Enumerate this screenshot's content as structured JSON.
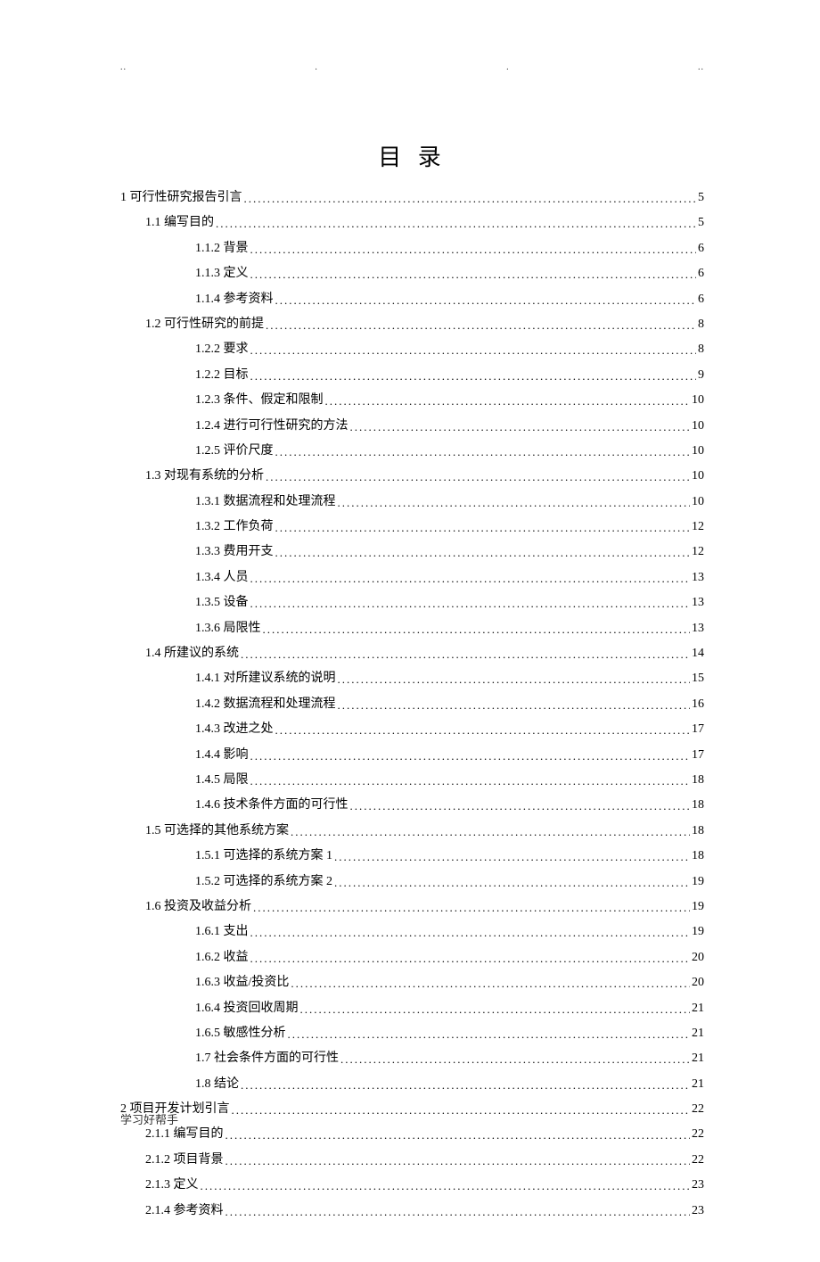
{
  "title": "目 录",
  "footer": "学习好帮手",
  "marker_chars": [
    "..",
    ".",
    ".",
    ".."
  ],
  "toc": [
    {
      "level": 1,
      "num": "1",
      "text": "可行性研究报告引言",
      "page": "5"
    },
    {
      "level": 2,
      "num": "1.1",
      "text": "编写目的",
      "page": "5"
    },
    {
      "level": 3,
      "num": "1.1.2",
      "text": "背景",
      "page": "6"
    },
    {
      "level": 3,
      "num": "1.1.3",
      "text": "定义",
      "page": "6"
    },
    {
      "level": 3,
      "num": "1.1.4",
      "text": "参考资料",
      "page": "6"
    },
    {
      "level": 2,
      "num": "1.2",
      "text": "可行性研究的前提",
      "page": "8"
    },
    {
      "level": 3,
      "num": "1.2.2",
      "text": "要求",
      "page": "8"
    },
    {
      "level": 3,
      "num": "1.2.2",
      "text": "目标",
      "page": "9"
    },
    {
      "level": 3,
      "num": "1.2.3",
      "text": "条件、假定和限制",
      "page": "10"
    },
    {
      "level": 3,
      "num": "1.2.4",
      "text": "进行可行性研究的方法",
      "page": "10"
    },
    {
      "level": 3,
      "num": "1.2.5",
      "text": "评价尺度",
      "page": "10"
    },
    {
      "level": 2,
      "num": "1.3",
      "text": "对现有系统的分析",
      "page": "10"
    },
    {
      "level": 3,
      "num": "1.3.1",
      "text": "数据流程和处理流程",
      "page": "10"
    },
    {
      "level": 3,
      "num": "1.3.2",
      "text": "工作负荷",
      "page": "12"
    },
    {
      "level": 3,
      "num": "1.3.3",
      "text": "费用开支",
      "page": "12"
    },
    {
      "level": 3,
      "num": "1.3.4",
      "text": "人员",
      "page": "13"
    },
    {
      "level": 3,
      "num": "1.3.5",
      "text": "设备",
      "page": "13"
    },
    {
      "level": 3,
      "num": "1.3.6",
      "text": "局限性",
      "page": "13"
    },
    {
      "level": 2,
      "num": "1.4",
      "text": "所建议的系统",
      "page": "14"
    },
    {
      "level": 3,
      "num": "1.4.1",
      "text": "对所建议系统的说明",
      "page": "15"
    },
    {
      "level": 3,
      "num": "1.4.2",
      "text": "数据流程和处理流程",
      "page": "16"
    },
    {
      "level": 3,
      "num": "1.4.3",
      "text": "改进之处",
      "page": "17"
    },
    {
      "level": 3,
      "num": "1.4.4",
      "text": "影响",
      "page": "17"
    },
    {
      "level": 3,
      "num": "1.4.5",
      "text": "局限",
      "page": "18"
    },
    {
      "level": 3,
      "num": "1.4.6",
      "text": "技术条件方面的可行性",
      "page": "18"
    },
    {
      "level": 2,
      "num": "1.5",
      "text": "可选择的其他系统方案",
      "page": "18"
    },
    {
      "level": 3,
      "num": "1.5.1",
      "text": "可选择的系统方案 1",
      "page": "18"
    },
    {
      "level": 3,
      "num": "1.5.2",
      "text": "可选择的系统方案 2",
      "page": "19"
    },
    {
      "level": 2,
      "num": "1.6",
      "text": "投资及收益分析",
      "page": "19"
    },
    {
      "level": 3,
      "num": "1.6.1",
      "text": "支出",
      "page": "19"
    },
    {
      "level": 3,
      "num": "1.6.2",
      "text": "收益",
      "page": "20"
    },
    {
      "level": 3,
      "num": "1.6.3",
      "text": "收益/投资比",
      "page": "20"
    },
    {
      "level": 3,
      "num": "1.6.4",
      "text": "投资回收周期",
      "page": "21"
    },
    {
      "level": 3,
      "num": "1.6.5",
      "text": "敏感性分析",
      "page": "21"
    },
    {
      "level": 3,
      "num": "1.7",
      "text": "社会条件方面的可行性",
      "page": "21"
    },
    {
      "level": 3,
      "num": "1.8",
      "text": "结论",
      "page": "21"
    },
    {
      "level": 1,
      "num": "2",
      "text": "项目开发计划引言",
      "page": "22"
    },
    {
      "level": 2,
      "num": "2.1.1",
      "text": "编写目的",
      "page": "22"
    },
    {
      "level": 2,
      "num": "2.1.2",
      "text": "项目背景",
      "page": "22"
    },
    {
      "level": 2,
      "num": "2.1.3",
      "text": "定义",
      "page": "23"
    },
    {
      "level": 2,
      "num": "2.1.4",
      "text": "参考资料",
      "page": "23"
    }
  ]
}
